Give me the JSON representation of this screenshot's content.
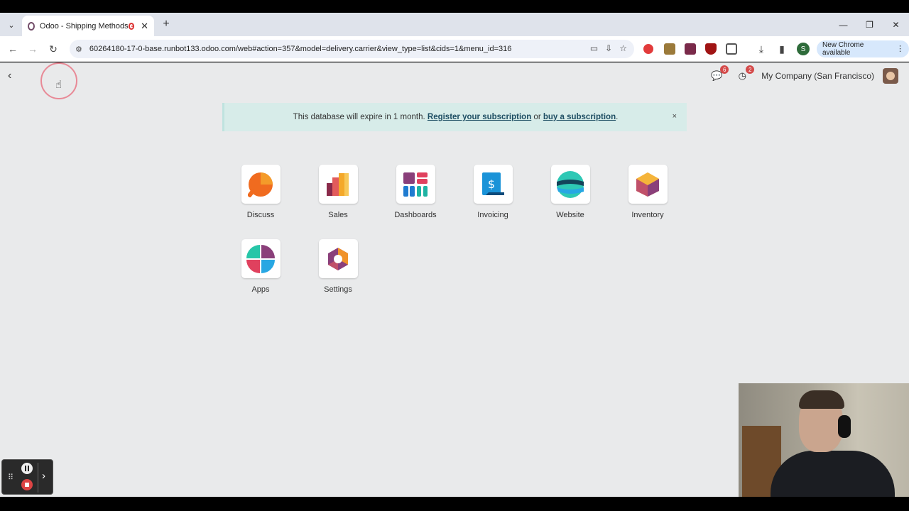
{
  "browser": {
    "tab_title": "Odoo - Shipping Methods",
    "new_tab_label": "+",
    "url": "60264180-17-0-base.runbot133.odoo.com/web#action=357&model=delivery.carrier&view_type=list&cids=1&menu_id=316",
    "new_chrome_label": "New Chrome available",
    "profile_initial": "S"
  },
  "navbar": {
    "messages_badge": "6",
    "activities_badge": "2",
    "company": "My Company (San Francisco)"
  },
  "banner": {
    "text_before": "This database will expire in 1 month. ",
    "register_link": "Register your subscription",
    "text_middle": " or ",
    "buy_link": "buy a subscription",
    "text_after": ".",
    "close": "×"
  },
  "apps": [
    {
      "label": "Discuss",
      "icon": "discuss-icon"
    },
    {
      "label": "Sales",
      "icon": "sales-icon"
    },
    {
      "label": "Dashboards",
      "icon": "dashboards-icon"
    },
    {
      "label": "Invoicing",
      "icon": "invoicing-icon"
    },
    {
      "label": "Website",
      "icon": "website-icon"
    },
    {
      "label": "Inventory",
      "icon": "inventory-icon"
    },
    {
      "label": "Apps",
      "icon": "apps-icon"
    },
    {
      "label": "Settings",
      "icon": "settings-icon"
    }
  ],
  "colors": {
    "odoo_purple": "#714b67",
    "banner_bg": "#d7ece9",
    "page_bg": "#e9eaeb",
    "badge_red": "#d44a4a"
  }
}
